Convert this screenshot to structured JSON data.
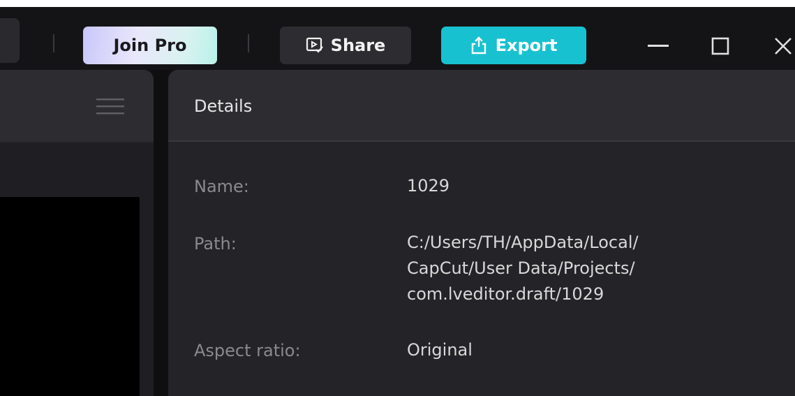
{
  "toolbar": {
    "join_pro_label": "Join Pro",
    "share_label": "Share",
    "export_label": "Export",
    "accent_color": "#18c1d0"
  },
  "window_controls": {
    "minimize_icon": "minimize-icon",
    "maximize_icon": "maximize-icon",
    "close_icon": "close-icon"
  },
  "details": {
    "title": "Details",
    "rows": [
      {
        "label": "Name:",
        "value_lines": [
          "1029"
        ]
      },
      {
        "label": "Path:",
        "value_lines": [
          "C:/Users/TH/AppData/Local/",
          "CapCut/User Data/Projects/",
          "com.lveditor.draft/1029"
        ]
      },
      {
        "label": "Aspect ratio:",
        "value_lines": [
          "Original"
        ]
      }
    ]
  }
}
